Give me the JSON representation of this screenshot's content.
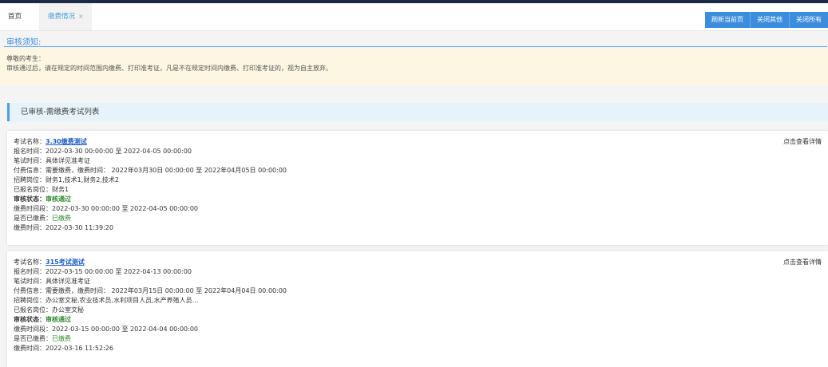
{
  "tabs": {
    "home": "首页",
    "active": "缴费情况",
    "close": "×"
  },
  "toolbar": {
    "refresh": "刷新当前页",
    "close_others": "关闭其他",
    "close_all": "关闭所有"
  },
  "notice": {
    "title": "审核须知:",
    "greeting": "尊敬的考生：",
    "body": "审核通过后，请在规定的时间范围内缴费、打印准考证，凡是不在规定时间内缴费、打印准考证的，视为自主放弃。"
  },
  "section": {
    "title": "已审核-需缴费考试列表"
  },
  "labels": {
    "exam_name": "考试名称：",
    "signup_time": "报名时间：",
    "written_time": "笔试时间：",
    "payment_info": "付费信息：",
    "positions": "招聘岗位：",
    "applied_position": "已报名岗位：",
    "review_status": "审核状态：",
    "payment_period": "缴费时间段：",
    "paid": "是否已缴费：",
    "pay_time": "缴费时间：",
    "detail": "点击查看详情"
  },
  "exams": [
    {
      "name": "3.30缴费测试",
      "signup_time": "2022-03-30 00:00:00 至 2022-04-05 00:00:00",
      "written_time": "具体详见准考证",
      "payment_info": "需要缴费，缴费时间：  2022年03月30日 00:00:00 至 2022年04月05日 00:00:00",
      "positions": "财务1,技术1,财务2,技术2",
      "applied_position": "财务1",
      "review_status": "审核通过",
      "payment_period": "2022-03-30 00:00:00 至 2022-04-05 00:00:00",
      "paid": "已缴费",
      "pay_time": "2022-03-30 11:39:20"
    },
    {
      "name": "315考试测试",
      "signup_time": "2022-03-15 00:00:00 至 2022-04-13 00:00:00",
      "written_time": "具体详见准考证",
      "payment_info": "需要缴费，缴费时间：  2022年03月15日 00:00:00 至 2022年04月04日 00:00:00",
      "positions": "办公室文秘,农业技术员,水利项目人员,水产养殖人员...",
      "applied_position": "办公室文秘",
      "review_status": "审核通过",
      "payment_period": "2022-03-15 00:00:00 至 2022-04-04 00:00:00",
      "paid": "已缴费",
      "pay_time": "2022-03-16 11:52:26"
    }
  ]
}
